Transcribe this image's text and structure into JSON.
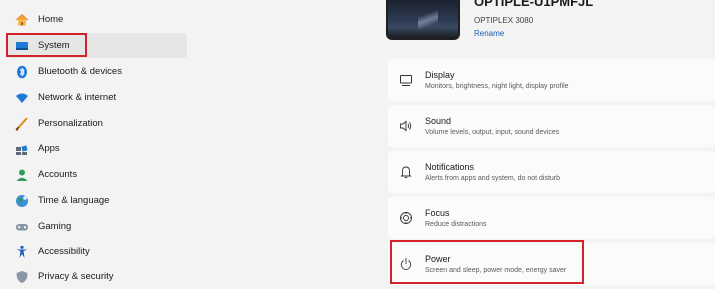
{
  "sidebar": {
    "items": [
      {
        "label": "Home",
        "icon": "home-icon"
      },
      {
        "label": "System",
        "icon": "system-icon"
      },
      {
        "label": "Bluetooth & devices",
        "icon": "bluetooth-icon"
      },
      {
        "label": "Network & internet",
        "icon": "network-icon"
      },
      {
        "label": "Personalization",
        "icon": "brush-icon"
      },
      {
        "label": "Apps",
        "icon": "apps-icon"
      },
      {
        "label": "Accounts",
        "icon": "accounts-icon"
      },
      {
        "label": "Time & language",
        "icon": "globe-icon"
      },
      {
        "label": "Gaming",
        "icon": "gamepad-icon"
      },
      {
        "label": "Accessibility",
        "icon": "accessibility-icon"
      },
      {
        "label": "Privacy & security",
        "icon": "shield-icon"
      }
    ],
    "selected": "System"
  },
  "device": {
    "name": "OPTIPLE-U1PMFJL",
    "model": "OPTIPLEX 3080",
    "rename_label": "Rename"
  },
  "settings": [
    {
      "title": "Display",
      "description": "Monitors, brightness, night light, display profile",
      "icon": "monitor-icon"
    },
    {
      "title": "Sound",
      "description": "Volume levels, output, input, sound devices",
      "icon": "speaker-icon"
    },
    {
      "title": "Notifications",
      "description": "Alerts from apps and system, do not disturb",
      "icon": "bell-icon"
    },
    {
      "title": "Focus",
      "description": "Reduce distractions",
      "icon": "focus-icon"
    },
    {
      "title": "Power",
      "description": "Screen and sleep, power mode, energy saver",
      "icon": "power-icon"
    }
  ],
  "colors": {
    "highlight": "#d3222a",
    "accent": "#1a5fb4",
    "background": "#f3f3f3"
  }
}
